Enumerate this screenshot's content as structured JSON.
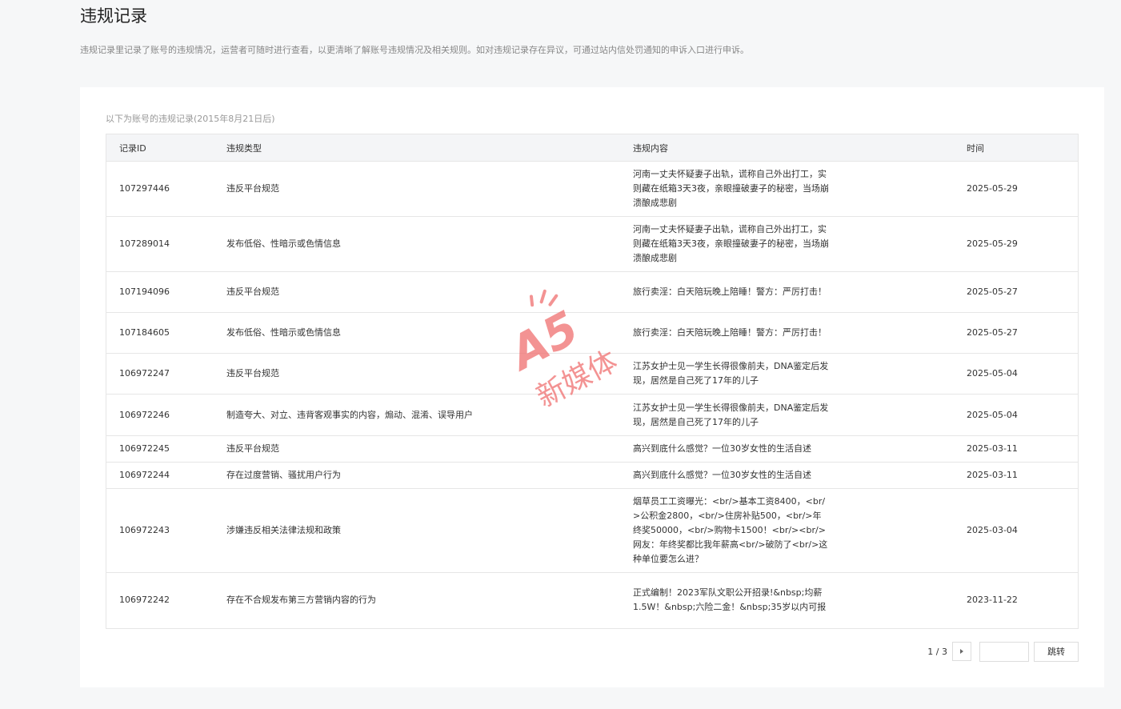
{
  "page": {
    "title": "违规记录",
    "description": "违规记录里记录了账号的违规情况，运营者可随时进行查看，以更清晰了解账号违规情况及相关规则。如对违规记录存在异议，可通过站内信处罚通知的申诉入口进行申诉。"
  },
  "records": {
    "subtitle": "以下为账号的违规记录(2015年8月21日后)",
    "columns": {
      "id": "记录ID",
      "type": "违规类型",
      "content": "违规内容",
      "time": "时间"
    },
    "rows": [
      {
        "id": "107297446",
        "type": "违反平台规范",
        "content": "河南一丈夫怀疑妻子出轨，谎称自己外出打工，实则藏在纸箱3天3夜，亲眼撞破妻子的秘密，当场崩溃酿成悲剧",
        "time": "2025-05-29"
      },
      {
        "id": "107289014",
        "type": "发布低俗、性暗示或色情信息",
        "content": "河南一丈夫怀疑妻子出轨，谎称自己外出打工，实则藏在纸箱3天3夜，亲眼撞破妻子的秘密，当场崩溃酿成悲剧",
        "time": "2025-05-29"
      },
      {
        "id": "107194096",
        "type": "违反平台规范",
        "content": "旅行卖淫：白天陪玩晚上陪睡！警方：严厉打击！",
        "time": "2025-05-27"
      },
      {
        "id": "107184605",
        "type": "发布低俗、性暗示或色情信息",
        "content": "旅行卖淫：白天陪玩晚上陪睡！警方：严厉打击！",
        "time": "2025-05-27"
      },
      {
        "id": "106972247",
        "type": "违反平台规范",
        "content": "江苏女护士见一学生长得很像前夫，DNA鉴定后发现，居然是自己死了17年的儿子",
        "time": "2025-05-04"
      },
      {
        "id": "106972246",
        "type": "制造夸大、对立、违背客观事实的内容，煽动、混淆、误导用户",
        "content": "江苏女护士见一学生长得很像前夫，DNA鉴定后发现，居然是自己死了17年的儿子",
        "time": "2025-05-04"
      },
      {
        "id": "106972245",
        "type": "违反平台规范",
        "content": "高兴到底什么感觉？一位30岁女性的生活自述",
        "time": "2025-03-11"
      },
      {
        "id": "106972244",
        "type": "存在过度营销、骚扰用户行为",
        "content": "高兴到底什么感觉？一位30岁女性的生活自述",
        "time": "2025-03-11"
      },
      {
        "id": "106972243",
        "type": "涉嫌违反相关法律法规和政策",
        "content": "烟草员工工资曝光：<br/>基本工资8400，<br/>公积金2800，<br/>住房补贴500，<br/>年终奖50000，<br/>购物卡1500！<br/><br/>网友：年终奖都比我年薪高<br/>破防了<br/>这种单位要怎么进？",
        "time": "2025-03-04"
      },
      {
        "id": "106972242",
        "type": "存在不合规发布第三方营销内容的行为",
        "content": "正式编制！2023军队文职公开招录!&nbsp;均薪1.5W！&nbsp;六险二金！&nbsp;35岁以内可报",
        "time": "2023-11-22"
      }
    ]
  },
  "pagination": {
    "info": "1 / 3",
    "jump_label": "跳转",
    "input_value": ""
  },
  "watermark": {
    "logo_text": "A5",
    "brand_text": "新媒体",
    "color": "#f07070"
  }
}
